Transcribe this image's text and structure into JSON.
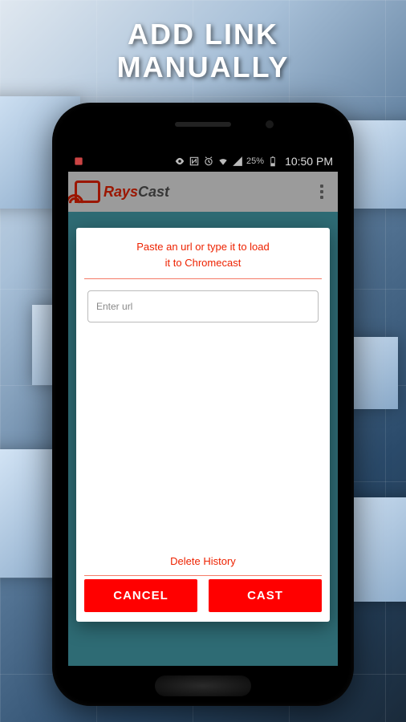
{
  "promo": {
    "heading_line1": "ADD LINK",
    "heading_line2": "MANUALLY"
  },
  "statusbar": {
    "battery_pct": "25%",
    "clock": "10:50 PM"
  },
  "appbar": {
    "brand_prefix": "Rays",
    "brand_suffix": "Cast",
    "icons": {
      "logo": "cast-icon",
      "overflow": "more-vert-icon"
    }
  },
  "dialog": {
    "title_line1": "Paste an url or type it to load",
    "title_line2": "it to Chromecast",
    "url_placeholder": "Enter url",
    "url_value": "",
    "delete_history_label": "Delete History",
    "cancel_label": "CANCEL",
    "cast_label": "CAST"
  },
  "colors": {
    "accent": "#e20",
    "button_bg": "#f00",
    "screen_bg": "#2e6b74"
  }
}
